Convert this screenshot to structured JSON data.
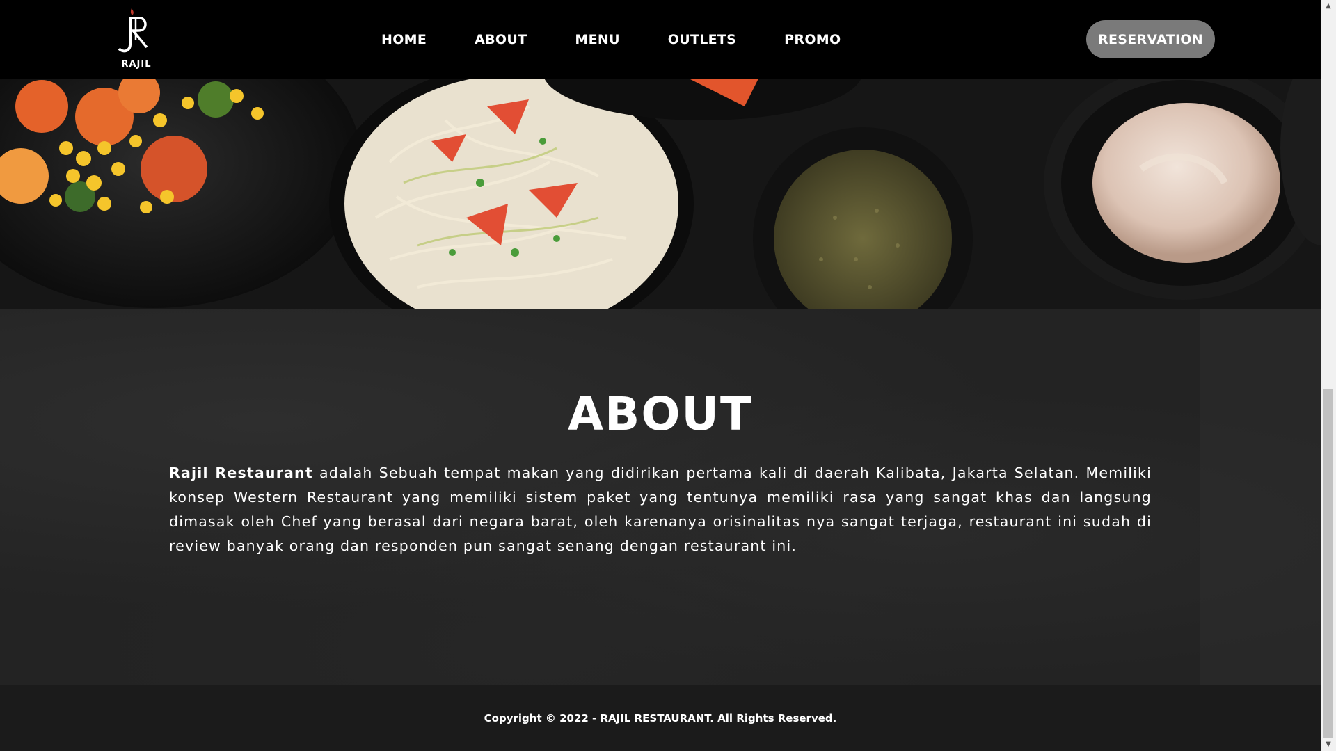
{
  "header": {
    "logo_text": "RAJIL",
    "nav": [
      "HOME",
      "ABOUT",
      "MENU",
      "OUTLETS",
      "PROMO"
    ],
    "reservation_label": "RESERVATION"
  },
  "about": {
    "title": "ABOUT",
    "brand": "Rajil Restaurant",
    "body": " adalah Sebuah tempat makan yang didirikan pertama kali di daerah Kalibata, Jakarta Selatan. Memiliki konsep Western Restaurant yang memiliki sistem paket yang tentunya memiliki rasa yang sangat khas dan langsung dimasak oleh Chef yang berasal dari negara barat, oleh karenanya orisinalitas nya sangat terjaga, restaurant ini sudah di review banyak orang dan responden pun sangat senang dengan restaurant ini."
  },
  "footer": {
    "copyright": "Copyright © 2022 - RAJIL RESTAURANT. All Rights Reserved."
  },
  "colors": {
    "header_bg": "#000000",
    "button_bg": "#7a7a7a",
    "footer_bg": "#1b1b1b",
    "section_bg": "#232323"
  },
  "icons": {
    "logo": "rajil-logo-icon",
    "scroll_up": "chevron-up-icon",
    "scroll_down": "chevron-down-icon"
  }
}
